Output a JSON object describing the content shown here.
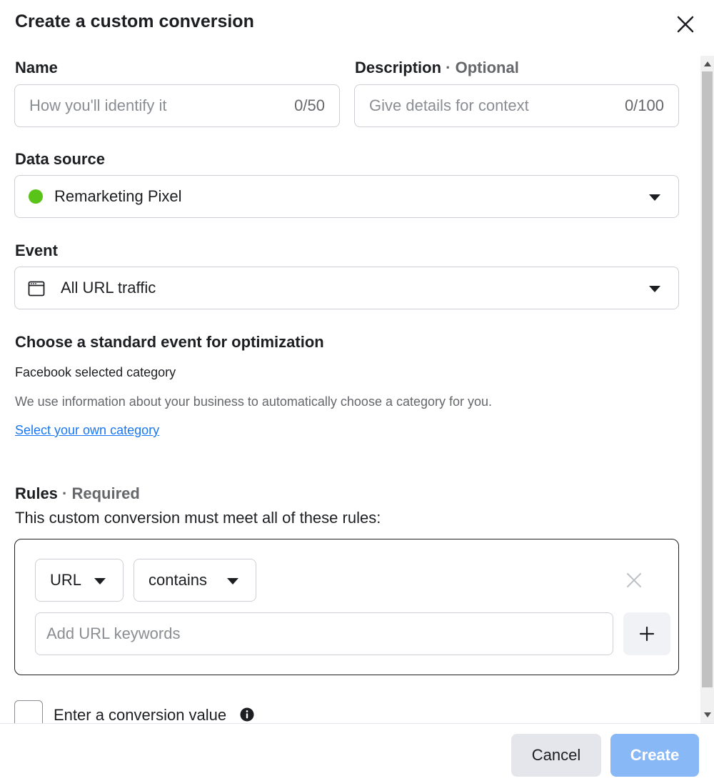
{
  "dialog": {
    "title": "Create a custom conversion"
  },
  "name_field": {
    "label": "Name",
    "placeholder": "How you'll identify it",
    "counter": "0/50"
  },
  "description_field": {
    "label": "Description",
    "optional": "· Optional",
    "placeholder": "Give details for context",
    "counter": "0/100"
  },
  "data_source": {
    "label": "Data source",
    "value": "Remarketing Pixel",
    "status_color": "#5ac317"
  },
  "event": {
    "label": "Event",
    "value": "All URL traffic",
    "icon": "browser-window-icon"
  },
  "standard_event": {
    "heading": "Choose a standard event for optimization",
    "selected": "Facebook selected category",
    "info": "We use information about your business to automatically choose a category for you.",
    "link": "Select your own category"
  },
  "rules": {
    "label": "Rules",
    "required": "· Required",
    "description": "This custom conversion must meet all of these rules:",
    "field_select": "URL",
    "operator_select": "contains",
    "keyword_placeholder": "Add URL keywords"
  },
  "conversion_value": {
    "label": "Enter a conversion value"
  },
  "footer": {
    "cancel": "Cancel",
    "create": "Create"
  },
  "colors": {
    "primary_disabled": "#89b8f7",
    "link": "#1877f2"
  }
}
